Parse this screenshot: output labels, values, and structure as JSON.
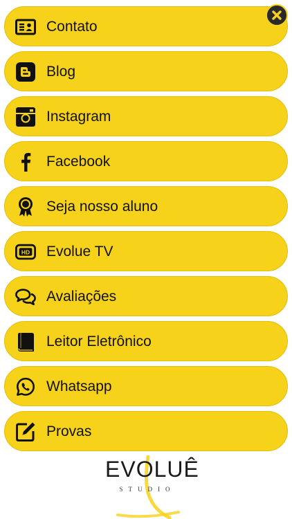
{
  "close_button": {
    "icon": "close-icon",
    "color": "#2a2a2a"
  },
  "menu": {
    "accent_color": "#f6d21b",
    "items": [
      {
        "label": "Contato",
        "icon": "contact-card-icon"
      },
      {
        "label": "Blog",
        "icon": "blogger-icon"
      },
      {
        "label": "Instagram",
        "icon": "instagram-icon"
      },
      {
        "label": "Facebook",
        "icon": "facebook-icon"
      },
      {
        "label": "Seja nosso aluno",
        "icon": "award-badge-icon"
      },
      {
        "label": "Evolue TV",
        "icon": "hd-tv-icon"
      },
      {
        "label": "Avaliações",
        "icon": "comments-icon"
      },
      {
        "label": "Leitor Eletrônico",
        "icon": "book-icon"
      },
      {
        "label": "Whatsapp",
        "icon": "whatsapp-icon"
      },
      {
        "label": "Provas",
        "icon": "edit-icon"
      }
    ]
  },
  "logo": {
    "word": "EVOLUÊ",
    "sub": "STUDIO"
  }
}
